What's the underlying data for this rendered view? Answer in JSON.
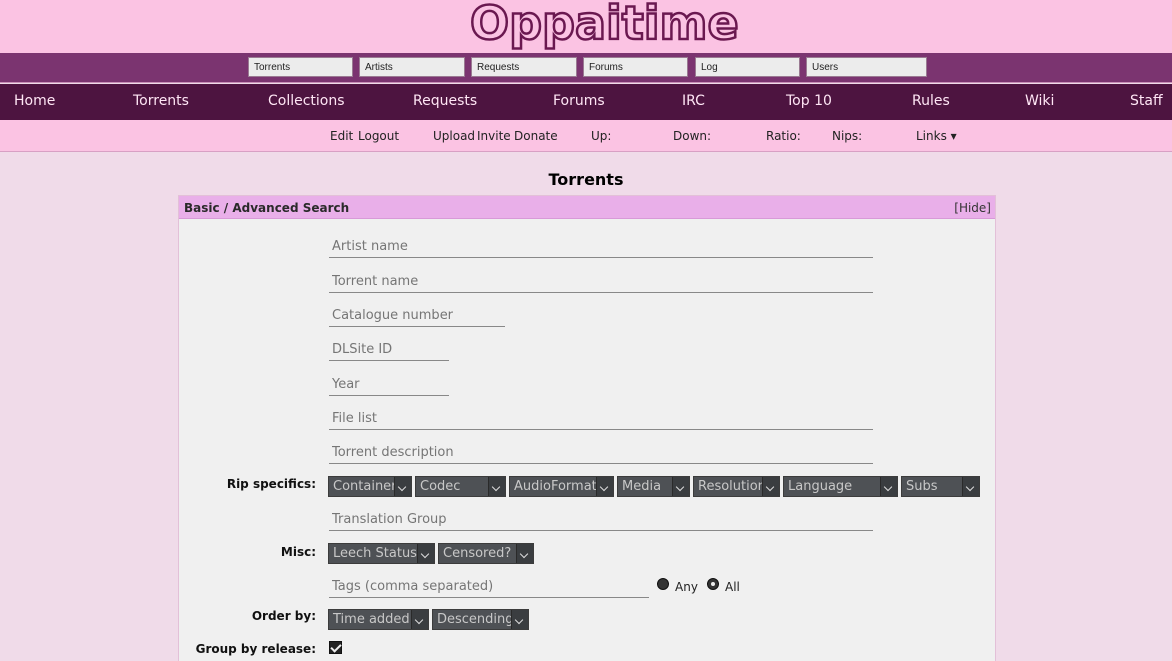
{
  "site": {
    "logo": "Oppaitime"
  },
  "quick_search": {
    "placeholders": [
      "Torrents",
      "Artists",
      "Requests",
      "Forums",
      "Log",
      "Users"
    ]
  },
  "main_nav": [
    "Home",
    "Torrents",
    "Collections",
    "Requests",
    "Forums",
    "IRC",
    "Top 10",
    "Rules",
    "Wiki",
    "Staff"
  ],
  "user_bar": {
    "edit": "Edit",
    "logout": "Logout",
    "upload": "Upload",
    "invite": "Invite",
    "donate": "Donate",
    "up_label": "Up:",
    "down_label": "Down:",
    "ratio_label": "Ratio:",
    "nips_label": "Nips:",
    "links_label": "Links ▾"
  },
  "page_title": "Torrents",
  "search_box": {
    "title": "Basic / Advanced Search",
    "hide_link": "[Hide]",
    "fields": {
      "artist": "Artist name",
      "torrent": "Torrent name",
      "catalogue": "Catalogue number",
      "dlsite": "DLSite ID",
      "year": "Year",
      "filelist": "File list",
      "description": "Torrent description",
      "translation": "Translation Group",
      "tags": "Tags (comma separated)"
    },
    "labels": {
      "rip": "Rip specifics:",
      "misc": "Misc:",
      "order": "Order by:",
      "group": "Group by release:"
    },
    "rip_selects": [
      "Container",
      "Codec",
      "AudioFormat",
      "Media",
      "Resolution",
      "Language",
      "Subs"
    ],
    "misc_selects": [
      "Leech Status",
      "Censored?"
    ],
    "order_selects": [
      "Time added",
      "Descending"
    ],
    "tag_modes": {
      "any": "Any",
      "all": "All",
      "selected": "all"
    },
    "group_by_release": true
  }
}
